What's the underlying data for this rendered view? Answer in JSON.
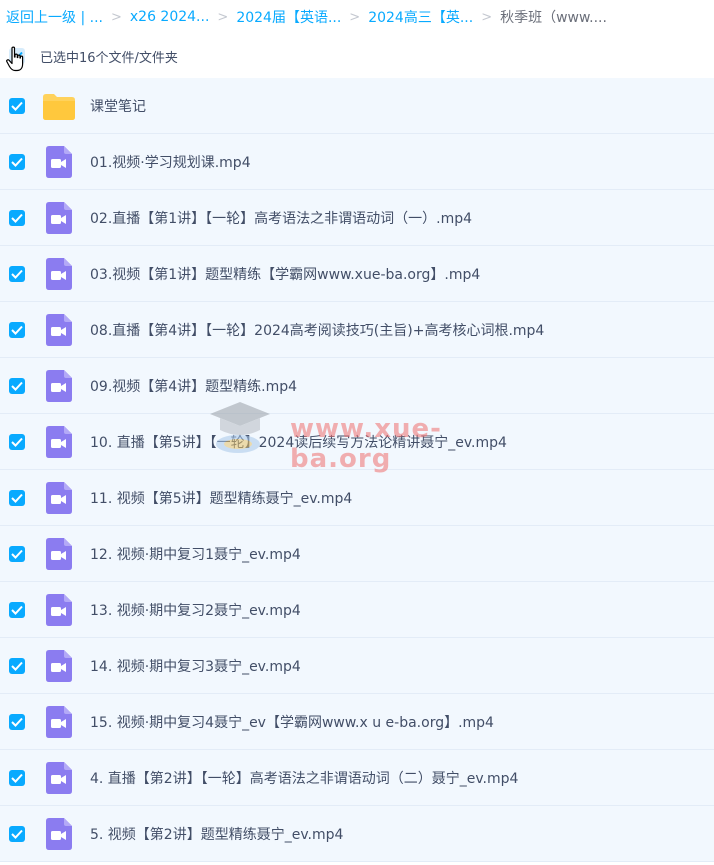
{
  "breadcrumb": {
    "items": [
      "返回上一级 | ...",
      "x26 2024...",
      "2024届【英语...",
      "2024高三【英...",
      "秋季班（www...."
    ]
  },
  "selection": {
    "label": "已选中16个文件/文件夹"
  },
  "files": [
    {
      "name": "课堂笔记",
      "icon": "folder-icon"
    },
    {
      "name": "01.视频·学习规划课.mp4",
      "icon": "video-icon"
    },
    {
      "name": "02.直播【第1讲】【一轮】高考语法之非谓语动词（一）.mp4",
      "icon": "video-icon"
    },
    {
      "name": "03.视频【第1讲】题型精练【学霸网www.xue-ba.org】.mp4",
      "icon": "video-icon"
    },
    {
      "name": "08.直播【第4讲】【一轮】2024高考阅读技巧(主旨)+高考核心词根.mp4",
      "icon": "video-icon"
    },
    {
      "name": "09.视频【第4讲】题型精练.mp4",
      "icon": "video-icon"
    },
    {
      "name": "10. 直播【第5讲】【一轮】2024读后续写方法论精讲聂宁_ev.mp4",
      "icon": "video-icon"
    },
    {
      "name": "11. 视频【第5讲】题型精练聂宁_ev.mp4",
      "icon": "video-icon"
    },
    {
      "name": "12. 视频·期中复习1聂宁_ev.mp4",
      "icon": "video-icon"
    },
    {
      "name": "13. 视频·期中复习2聂宁_ev.mp4",
      "icon": "video-icon"
    },
    {
      "name": "14. 视频·期中复习3聂宁_ev.mp4",
      "icon": "video-icon"
    },
    {
      "name": "15. 视频·期中复习4聂宁_ev【学霸网www.x u e-ba.org】.mp4",
      "icon": "video-icon"
    },
    {
      "name": "4. 直播【第2讲】【一轮】高考语法之非谓语动词（二）聂宁_ev.mp4",
      "icon": "video-icon"
    },
    {
      "name": "5. 视频【第2讲】题型精练聂宁_ev.mp4",
      "icon": "video-icon"
    }
  ],
  "watermark": {
    "text": "www.xue-ba.org"
  },
  "colors": {
    "accent": "#09aaff",
    "video": "#8b7cf0",
    "folder": "#ffd25c",
    "row_bg": "#f2f8fe"
  }
}
